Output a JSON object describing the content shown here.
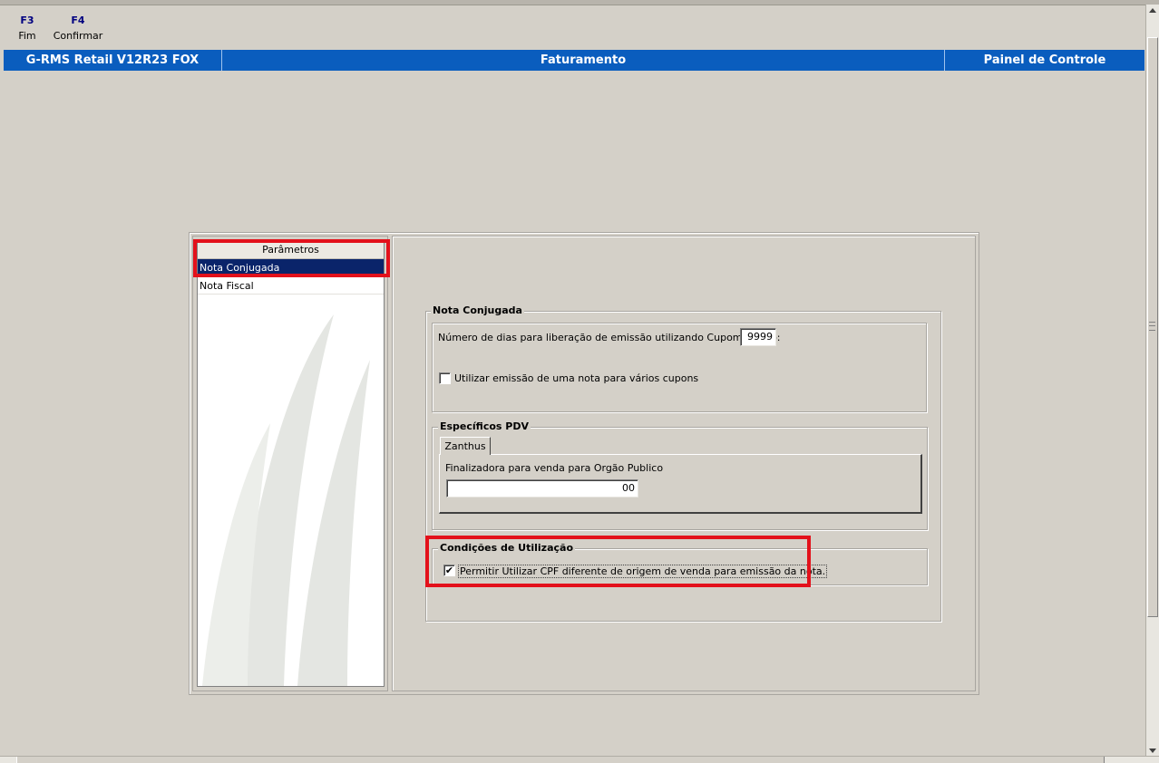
{
  "toolbar": {
    "keys": [
      {
        "key": "F3",
        "label": "Fim"
      },
      {
        "key": "F4",
        "label": "Confirmar"
      }
    ]
  },
  "titlebar": {
    "app": "G-RMS Retail V12R23 FOX",
    "module": "Faturamento",
    "section": "Painel de Controle"
  },
  "sidebar": {
    "header": "Parâmetros",
    "items": [
      {
        "label": "Nota Conjugada",
        "selected": true
      },
      {
        "label": "Nota Fiscal",
        "selected": false
      }
    ]
  },
  "nota_conjugada": {
    "title": "Nota Conjugada",
    "days_label": "Número de dias para liberação de emissão utilizando Cupom antigo:",
    "days_value": "9999",
    "multi_coupon_label": "Utilizar emissão de uma nota para vários cupons",
    "multi_coupon_checked": false
  },
  "especificos_pdv": {
    "title": "Específicos PDV",
    "tab": "Zanthus",
    "finalizadora_label": "Finalizadora para venda para Orgão Publico",
    "finalizadora_value": "00"
  },
  "condicoes": {
    "title": "Condições de Utilização",
    "cpf_label": "Permitir Utilizar CPF diferente de origem de venda para emissão da nota.",
    "cpf_checked": true
  },
  "colors": {
    "titlebar": "#0a5dbe",
    "selection": "#0a246a",
    "highlight": "#e3111b",
    "background": "#d4d0c8"
  }
}
